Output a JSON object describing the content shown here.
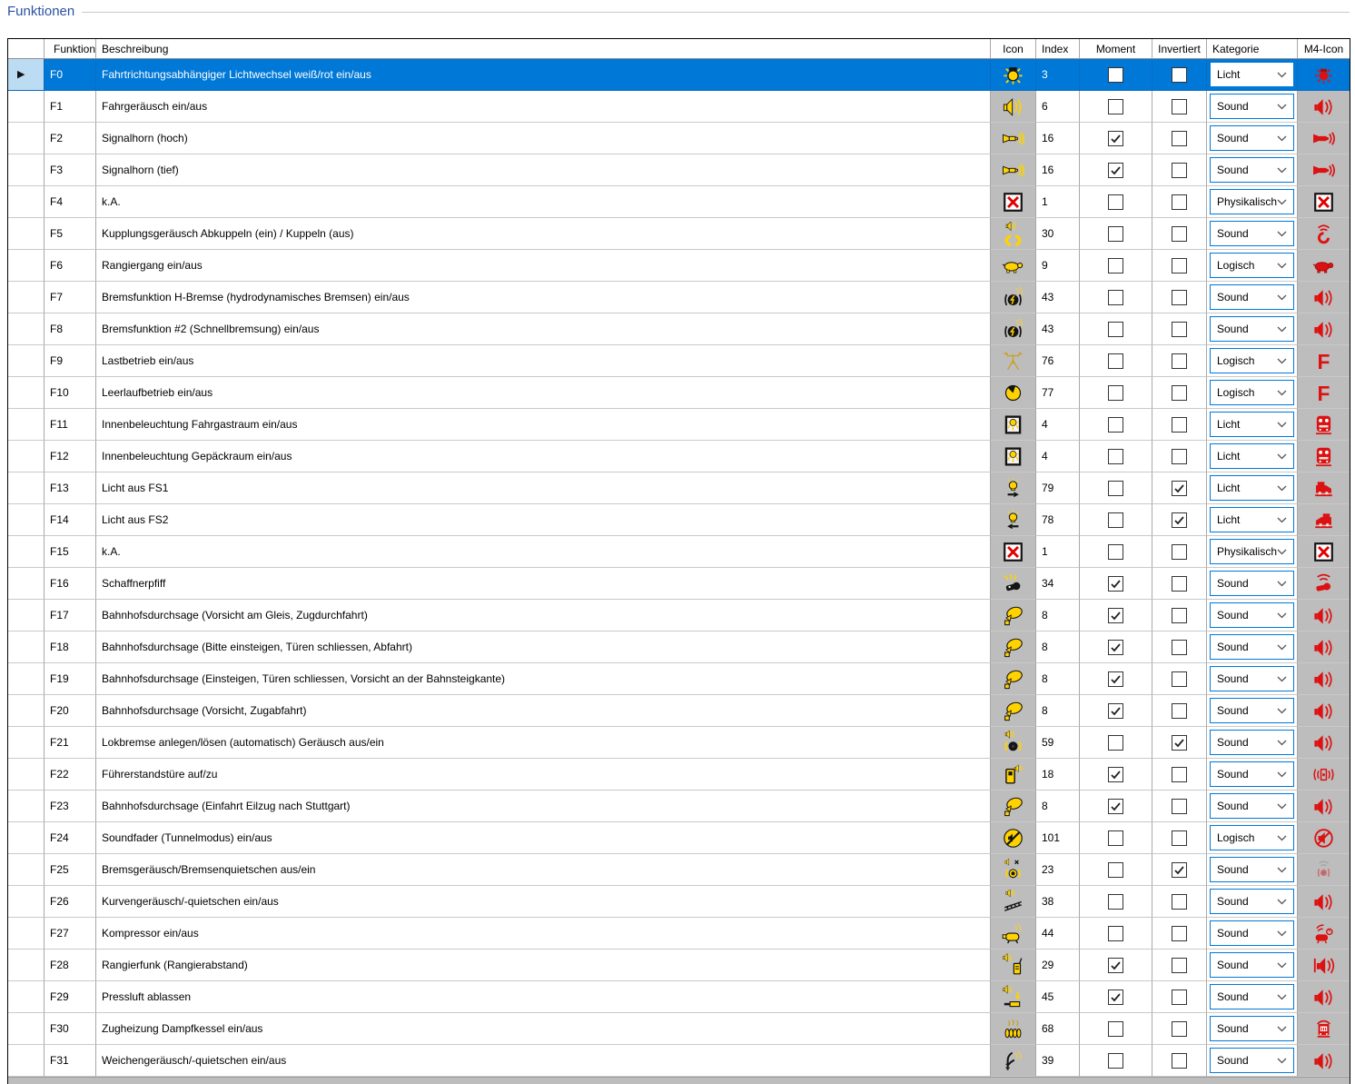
{
  "title": "Funktionen",
  "ui": {
    "current_row_marker": "▶"
  },
  "colors": {
    "selection_blue": "#0078d7",
    "header_highlight": "#bcdcf4",
    "icon_cell_gray": "#bdbdbd",
    "icon_yellow": "#ffd200",
    "m4_red": "#dd1111",
    "title_blue": "#2b52a3"
  },
  "table": {
    "headers": {
      "funktion": "Funktion",
      "beschreibung": "Beschreibung",
      "icon": "Icon",
      "index": "Index",
      "moment": "Moment",
      "invertiert": "Invertiert",
      "kategorie": "Kategorie",
      "m4": "M4-Icon"
    },
    "rows": [
      {
        "funktion": "F0",
        "beschreibung": "Fahrtrichtungsabhängiger Lichtwechsel weiß/rot ein/aus",
        "icon": "lamp-rays",
        "index": "3",
        "moment": false,
        "invertiert": false,
        "kategorie": "Licht",
        "m4": "m4-lamp",
        "selected": true
      },
      {
        "funktion": "F1",
        "beschreibung": "Fahrgeräusch ein/aus",
        "icon": "speaker-waves",
        "index": "6",
        "moment": false,
        "invertiert": false,
        "kategorie": "Sound",
        "m4": "m4-speaker",
        "selected": false
      },
      {
        "funktion": "F2",
        "beschreibung": "Signalhorn (hoch)",
        "icon": "horn",
        "index": "16",
        "moment": true,
        "invertiert": false,
        "kategorie": "Sound",
        "m4": "m4-horn",
        "selected": false
      },
      {
        "funktion": "F3",
        "beschreibung": "Signalhorn (tief)",
        "icon": "horn",
        "index": "16",
        "moment": true,
        "invertiert": false,
        "kategorie": "Sound",
        "m4": "m4-horn",
        "selected": false
      },
      {
        "funktion": "F4",
        "beschreibung": "k.A.",
        "icon": "x-box",
        "index": "1",
        "moment": false,
        "invertiert": false,
        "kategorie": "Physikalisch",
        "m4": "m4-x",
        "selected": false
      },
      {
        "funktion": "F5",
        "beschreibung": "Kupplungsgeräusch Abkuppeln (ein) / Kuppeln (aus)",
        "icon": "coupler-sound",
        "index": "30",
        "moment": false,
        "invertiert": false,
        "kategorie": "Sound",
        "m4": "m4-coupler",
        "selected": false
      },
      {
        "funktion": "F6",
        "beschreibung": "Rangiergang ein/aus",
        "icon": "turtle",
        "index": "9",
        "moment": false,
        "invertiert": false,
        "kategorie": "Logisch",
        "m4": "m4-turtle",
        "selected": false
      },
      {
        "funktion": "F7",
        "beschreibung": "Bremsfunktion H-Bremse (hydrodynamisches Bremsen) ein/aus",
        "icon": "brake-sound",
        "index": "43",
        "moment": false,
        "invertiert": false,
        "kategorie": "Sound",
        "m4": "m4-speaker",
        "selected": false
      },
      {
        "funktion": "F8",
        "beschreibung": "Bremsfunktion #2 (Schnellbremsung) ein/aus",
        "icon": "brake-sound",
        "index": "43",
        "moment": false,
        "invertiert": false,
        "kategorie": "Sound",
        "m4": "m4-speaker",
        "selected": false
      },
      {
        "funktion": "F9",
        "beschreibung": "Lastbetrieb ein/aus",
        "icon": "mast",
        "index": "76",
        "moment": false,
        "invertiert": false,
        "kategorie": "Logisch",
        "m4": "m4-F",
        "selected": false
      },
      {
        "funktion": "F10",
        "beschreibung": "Leerlaufbetrieb ein/aus",
        "icon": "gauge",
        "index": "77",
        "moment": false,
        "invertiert": false,
        "kategorie": "Logisch",
        "m4": "m4-F",
        "selected": false
      },
      {
        "funktion": "F11",
        "beschreibung": "Innenbeleuchtung Fahrgastraum ein/aus",
        "icon": "interior-light",
        "index": "4",
        "moment": false,
        "invertiert": false,
        "kategorie": "Licht",
        "m4": "m4-train-front",
        "selected": false
      },
      {
        "funktion": "F12",
        "beschreibung": "Innenbeleuchtung Gepäckraum ein/aus",
        "icon": "interior-light",
        "index": "4",
        "moment": false,
        "invertiert": false,
        "kategorie": "Licht",
        "m4": "m4-train-front",
        "selected": false
      },
      {
        "funktion": "F13",
        "beschreibung": "Licht aus FS1",
        "icon": "light-right",
        "index": "79",
        "moment": false,
        "invertiert": true,
        "kategorie": "Licht",
        "m4": "m4-train-right",
        "selected": false
      },
      {
        "funktion": "F14",
        "beschreibung": "Licht aus FS2",
        "icon": "light-left",
        "index": "78",
        "moment": false,
        "invertiert": true,
        "kategorie": "Licht",
        "m4": "m4-train-left",
        "selected": false
      },
      {
        "funktion": "F15",
        "beschreibung": "k.A.",
        "icon": "x-box",
        "index": "1",
        "moment": false,
        "invertiert": false,
        "kategorie": "Physikalisch",
        "m4": "m4-x",
        "selected": false
      },
      {
        "funktion": "F16",
        "beschreibung": "Schaffnerpfiff",
        "icon": "whistle",
        "index": "34",
        "moment": true,
        "invertiert": false,
        "kategorie": "Sound",
        "m4": "m4-whistle",
        "selected": false
      },
      {
        "funktion": "F17",
        "beschreibung": "Bahnhofsdurchsage (Vorsicht am Gleis, Zugdurchfahrt)",
        "icon": "megaphone",
        "index": "8",
        "moment": true,
        "invertiert": false,
        "kategorie": "Sound",
        "m4": "m4-speaker",
        "selected": false
      },
      {
        "funktion": "F18",
        "beschreibung": "Bahnhofsdurchsage (Bitte einsteigen, Türen schliessen, Abfahrt)",
        "icon": "megaphone",
        "index": "8",
        "moment": true,
        "invertiert": false,
        "kategorie": "Sound",
        "m4": "m4-speaker",
        "selected": false
      },
      {
        "funktion": "F19",
        "beschreibung": "Bahnhofsdurchsage (Einsteigen, Türen schliessen, Vorsicht an der Bahnsteigkante)",
        "icon": "megaphone",
        "index": "8",
        "moment": true,
        "invertiert": false,
        "kategorie": "Sound",
        "m4": "m4-speaker",
        "selected": false
      },
      {
        "funktion": "F20",
        "beschreibung": "Bahnhofsdurchsage (Vorsicht, Zugabfahrt)",
        "icon": "megaphone",
        "index": "8",
        "moment": true,
        "invertiert": false,
        "kategorie": "Sound",
        "m4": "m4-speaker",
        "selected": false
      },
      {
        "funktion": "F21",
        "beschreibung": "Lokbremse anlegen/lösen (automatisch) Geräusch aus/ein",
        "icon": "brake-sound2",
        "index": "59",
        "moment": false,
        "invertiert": true,
        "kategorie": "Sound",
        "m4": "m4-speaker",
        "selected": false
      },
      {
        "funktion": "F22",
        "beschreibung": "Führerstandstüre auf/zu",
        "icon": "door-sound",
        "index": "18",
        "moment": true,
        "invertiert": false,
        "kategorie": "Sound",
        "m4": "m4-door-sound",
        "selected": false
      },
      {
        "funktion": "F23",
        "beschreibung": "Bahnhofsdurchsage (Einfahrt Eilzug nach Stuttgart)",
        "icon": "megaphone",
        "index": "8",
        "moment": true,
        "invertiert": false,
        "kategorie": "Sound",
        "m4": "m4-speaker",
        "selected": false
      },
      {
        "funktion": "F24",
        "beschreibung": "Soundfader (Tunnelmodus) ein/aus",
        "icon": "mute",
        "index": "101",
        "moment": false,
        "invertiert": false,
        "kategorie": "Logisch",
        "m4": "m4-mute",
        "selected": false
      },
      {
        "funktion": "F25",
        "beschreibung": "Bremsgeräusch/Bremsenquietschen aus/ein",
        "icon": "brake-squeal-off",
        "index": "23",
        "moment": false,
        "invertiert": true,
        "kategorie": "Sound",
        "m4": "m4-brake-faded",
        "selected": false
      },
      {
        "funktion": "F26",
        "beschreibung": "Kurvengeräusch/-quietschen ein/aus",
        "icon": "curve-squeal",
        "index": "38",
        "moment": false,
        "invertiert": false,
        "kategorie": "Sound",
        "m4": "m4-speaker",
        "selected": false
      },
      {
        "funktion": "F27",
        "beschreibung": "Kompressor ein/aus",
        "icon": "compressor",
        "index": "44",
        "moment": false,
        "invertiert": false,
        "kategorie": "Sound",
        "m4": "m4-compressor",
        "selected": false
      },
      {
        "funktion": "F28",
        "beschreibung": "Rangierfunk (Rangierabstand)",
        "icon": "radio",
        "index": "29",
        "moment": true,
        "invertiert": false,
        "kategorie": "Sound",
        "m4": "m4-radio-speaker",
        "selected": false
      },
      {
        "funktion": "F29",
        "beschreibung": "Pressluft ablassen",
        "icon": "air-release",
        "index": "45",
        "moment": true,
        "invertiert": false,
        "kategorie": "Sound",
        "m4": "m4-speaker",
        "selected": false
      },
      {
        "funktion": "F30",
        "beschreibung": "Zugheizung Dampfkessel ein/aus",
        "icon": "heater",
        "index": "68",
        "moment": false,
        "invertiert": false,
        "kategorie": "Sound",
        "m4": "m4-heater-train",
        "selected": false
      },
      {
        "funktion": "F31",
        "beschreibung": "Weichengeräusch/-quietschen ein/aus",
        "icon": "switch-squeal",
        "index": "39",
        "moment": false,
        "invertiert": false,
        "kategorie": "Sound",
        "m4": "m4-speaker",
        "selected": false
      }
    ]
  }
}
